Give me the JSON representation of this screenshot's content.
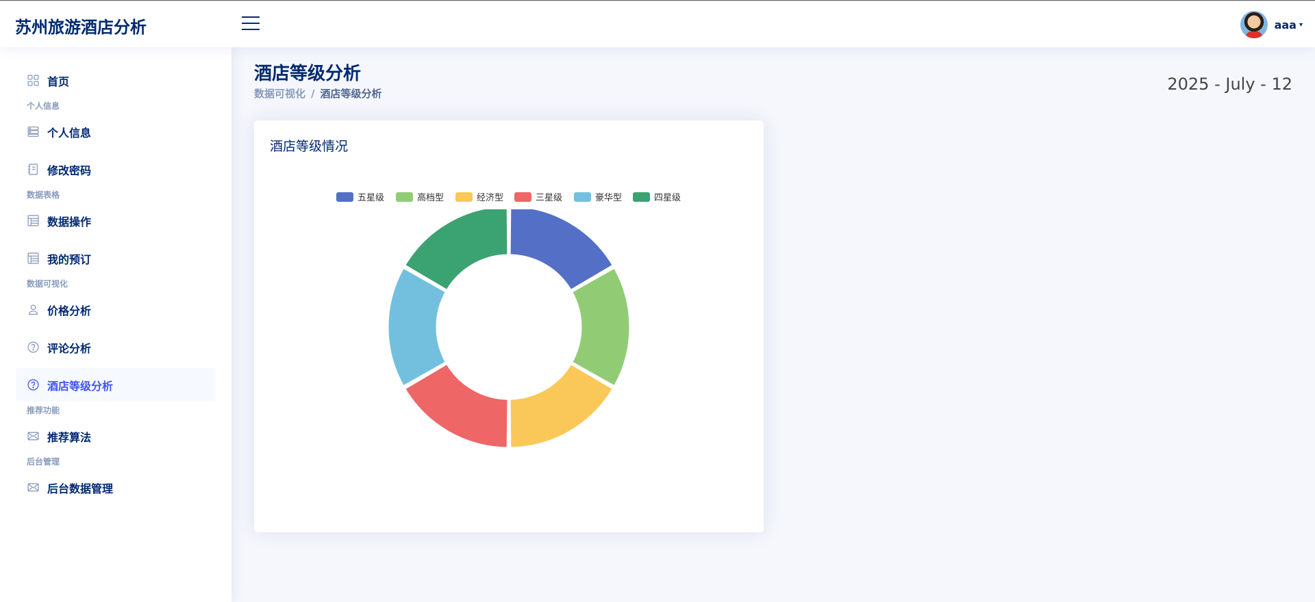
{
  "app": {
    "title": "苏州旅游酒店分析"
  },
  "user": {
    "name": "aaa",
    "caret": "▾"
  },
  "sidebar": {
    "items": [
      {
        "type": "item",
        "label": "首页",
        "icon": "grid-icon"
      },
      {
        "type": "heading",
        "label": "个人信息"
      },
      {
        "type": "item",
        "label": "个人信息",
        "icon": "server-icon"
      },
      {
        "type": "item",
        "label": "修改密码",
        "icon": "journal-icon"
      },
      {
        "type": "heading",
        "label": "数据表格"
      },
      {
        "type": "item",
        "label": "数据操作",
        "icon": "table-icon"
      },
      {
        "type": "item",
        "label": "我的预订",
        "icon": "table-icon"
      },
      {
        "type": "heading",
        "label": "数据可视化"
      },
      {
        "type": "item",
        "label": "价格分析",
        "icon": "person-icon"
      },
      {
        "type": "item",
        "label": "评论分析",
        "icon": "question-circle-icon"
      },
      {
        "type": "item",
        "label": "酒店等级分析",
        "icon": "question-circle-icon",
        "active": true
      },
      {
        "type": "heading",
        "label": "推荐功能"
      },
      {
        "type": "item",
        "label": "推荐算法",
        "icon": "envelope-icon"
      },
      {
        "type": "heading",
        "label": "后台管理"
      },
      {
        "type": "item",
        "label": "后台数据管理",
        "icon": "envelope-icon"
      }
    ]
  },
  "page": {
    "title": "酒店等级分析",
    "breadcrumb": [
      "数据可视化",
      "酒店等级分析"
    ],
    "breadcrumb_sep": "/",
    "date": "2025 - July - 12"
  },
  "card": {
    "title": "酒店等级情况"
  },
  "colors": {
    "brand": "#012970",
    "accent": "#4154f1",
    "muted": "#899bbd"
  },
  "chart_data": {
    "type": "pie",
    "variant": "donut",
    "title": "",
    "legend_position": "top-center",
    "categories": [
      "五星级",
      "高档型",
      "经济型",
      "三星级",
      "豪华型",
      "四星级"
    ],
    "values": [
      1,
      1,
      1,
      1,
      1,
      1
    ],
    "colors": [
      "#5470c6",
      "#91cc75",
      "#fac858",
      "#ee6666",
      "#73c0de",
      "#3ba272"
    ]
  }
}
